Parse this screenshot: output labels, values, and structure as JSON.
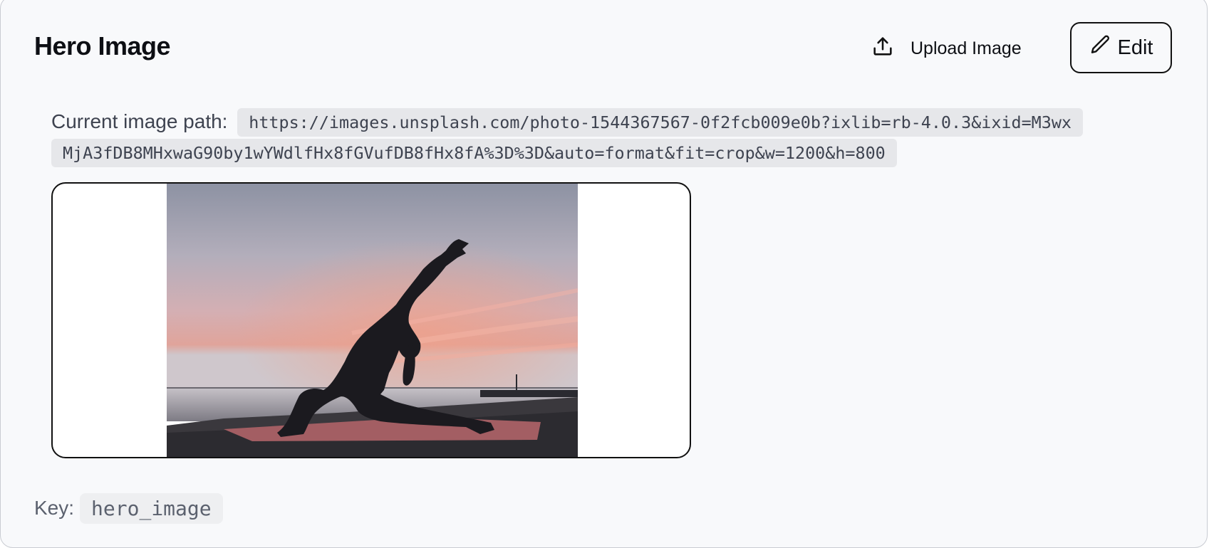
{
  "header": {
    "title": "Hero Image",
    "upload_label": "Upload Image",
    "upload_icon": "upload-icon",
    "edit_label": "Edit",
    "edit_icon": "pencil-icon"
  },
  "image": {
    "path_label": "Current image path:",
    "path_value": "https://images.unsplash.com/photo-1544367567-0f2fcb009e0b?ixlib=rb-4.0.3&ixid=M3wxMjA3fDB8MHxwaG90by1wYWdlfHx8fGVufDB8fHx8fA%3D%3D&auto=format&fit=crop&w=1200&h=800",
    "preview_subject": "silhouette of woman doing yoga lunge pose at sunset by the sea"
  },
  "key": {
    "label": "Key:",
    "value": "hero_image"
  },
  "colors": {
    "card_background": "#f8f9fb",
    "code_background": "#e6e7ea",
    "text_primary": "#0d0f14",
    "text_muted": "#5b616e"
  }
}
